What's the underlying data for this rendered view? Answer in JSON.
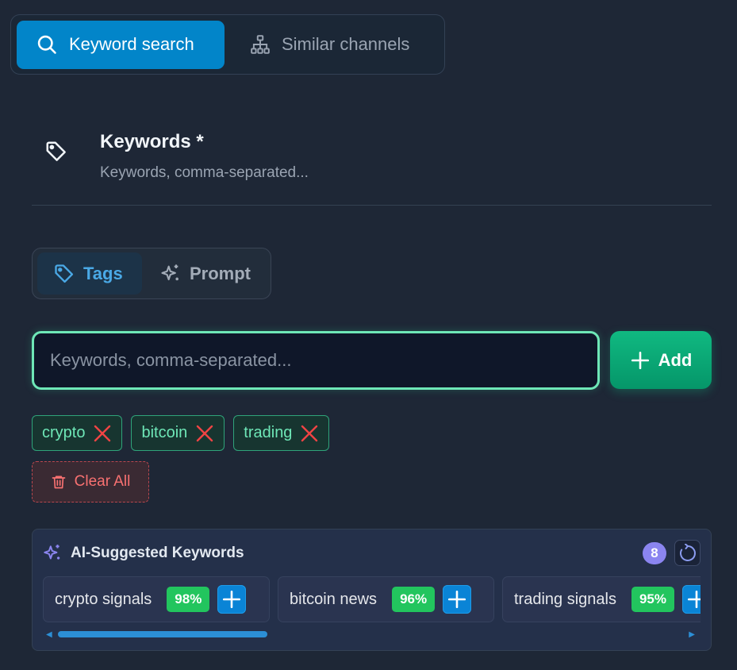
{
  "mode_switch": {
    "keyword_search": "Keyword search",
    "similar_channels": "Similar channels"
  },
  "keywords": {
    "title": "Keywords *",
    "subtitle": "Keywords, comma-separated..."
  },
  "input_mode": {
    "tags": "Tags",
    "prompt": "Prompt"
  },
  "input": {
    "placeholder": "Keywords, comma-separated...",
    "value": ""
  },
  "add_button": "Add",
  "tags": [
    {
      "label": "crypto"
    },
    {
      "label": "bitcoin"
    },
    {
      "label": "trading"
    }
  ],
  "clear_all": "Clear All",
  "ai_suggestions": {
    "title": "AI-Suggested Keywords",
    "count": "8",
    "items": [
      {
        "label": "crypto signals",
        "score": "98%"
      },
      {
        "label": "bitcoin news",
        "score": "96%"
      },
      {
        "label": "trading signals",
        "score": "95%"
      }
    ]
  },
  "colors": {
    "accent": "#0285c9",
    "success": "#10b981",
    "danger": "#f87171",
    "ai": "#8b85f0"
  }
}
